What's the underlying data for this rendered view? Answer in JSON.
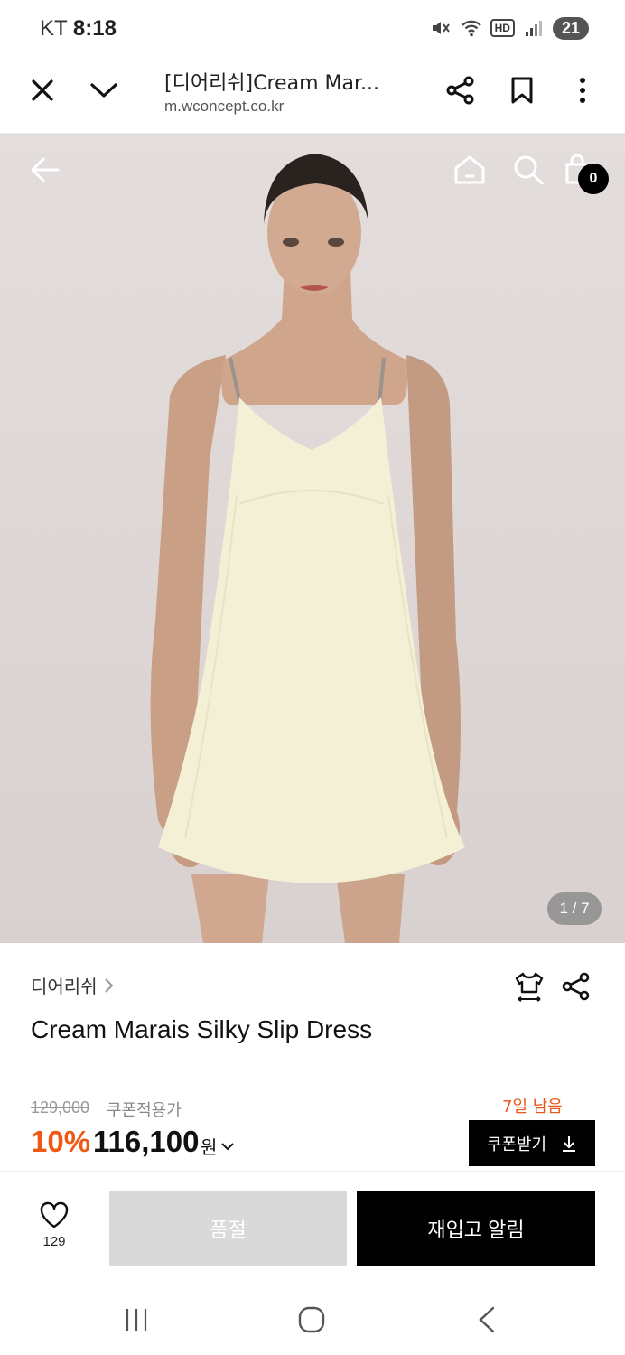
{
  "status_bar": {
    "carrier": "KT",
    "time": "8:18",
    "hd_label": "HD",
    "battery": "21"
  },
  "browser": {
    "title": "[디어리쉬]Cream Mar...",
    "url": "m.wconcept.co.kr"
  },
  "hero": {
    "cart_count": "0",
    "page_indicator": "1 / 7"
  },
  "product": {
    "brand": "디어리쉬",
    "name": "Cream Marais Silky Slip Dress",
    "original_price": "129,000",
    "coupon_note": "쿠폰적용가",
    "days_left": "7일 남음",
    "discount": "10%",
    "sale_price": "116,100",
    "currency": "원",
    "coupon_button": "쿠폰받기"
  },
  "purchase_bar": {
    "like_count": "129",
    "soldout_label": "품절",
    "restock_label": "재입고 알림"
  },
  "colors": {
    "accent": "#ee5a16",
    "primary_button": "#000000",
    "disabled_button": "#d9d9d9"
  },
  "icons": [
    "close-icon",
    "chevron-down-icon",
    "share-icon",
    "bookmark-icon",
    "more-vert-icon",
    "back-arrow-icon",
    "home-icon",
    "search-icon",
    "shopping-bag-icon",
    "size-guide-icon",
    "heart-icon",
    "recent-apps-icon",
    "home-circle-icon",
    "nav-back-icon"
  ]
}
